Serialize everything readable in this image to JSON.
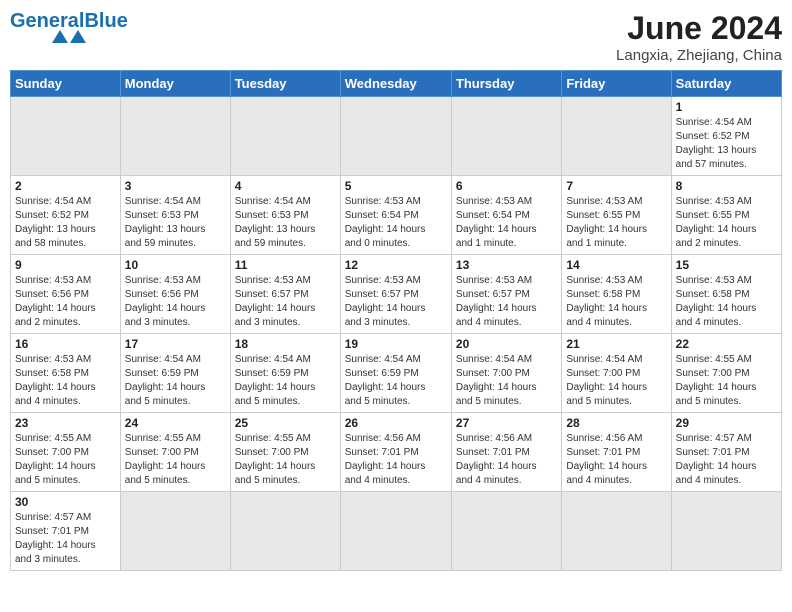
{
  "header": {
    "logo_general": "General",
    "logo_blue": "Blue",
    "month_year": "June 2024",
    "location": "Langxia, Zhejiang, China"
  },
  "weekdays": [
    "Sunday",
    "Monday",
    "Tuesday",
    "Wednesday",
    "Thursday",
    "Friday",
    "Saturday"
  ],
  "weeks": [
    [
      {
        "day": "",
        "info": "",
        "empty": true
      },
      {
        "day": "",
        "info": "",
        "empty": true
      },
      {
        "day": "",
        "info": "",
        "empty": true
      },
      {
        "day": "",
        "info": "",
        "empty": true
      },
      {
        "day": "",
        "info": "",
        "empty": true
      },
      {
        "day": "",
        "info": "",
        "empty": true
      },
      {
        "day": "1",
        "info": "Sunrise: 4:54 AM\nSunset: 6:52 PM\nDaylight: 13 hours\nand 57 minutes."
      }
    ],
    [
      {
        "day": "2",
        "info": "Sunrise: 4:54 AM\nSunset: 6:52 PM\nDaylight: 13 hours\nand 58 minutes."
      },
      {
        "day": "3",
        "info": "Sunrise: 4:54 AM\nSunset: 6:53 PM\nDaylight: 13 hours\nand 59 minutes."
      },
      {
        "day": "4",
        "info": "Sunrise: 4:54 AM\nSunset: 6:53 PM\nDaylight: 13 hours\nand 59 minutes."
      },
      {
        "day": "5",
        "info": "Sunrise: 4:53 AM\nSunset: 6:54 PM\nDaylight: 14 hours\nand 0 minutes."
      },
      {
        "day": "6",
        "info": "Sunrise: 4:53 AM\nSunset: 6:54 PM\nDaylight: 14 hours\nand 1 minute."
      },
      {
        "day": "7",
        "info": "Sunrise: 4:53 AM\nSunset: 6:55 PM\nDaylight: 14 hours\nand 1 minute."
      },
      {
        "day": "8",
        "info": "Sunrise: 4:53 AM\nSunset: 6:55 PM\nDaylight: 14 hours\nand 2 minutes."
      }
    ],
    [
      {
        "day": "9",
        "info": "Sunrise: 4:53 AM\nSunset: 6:56 PM\nDaylight: 14 hours\nand 2 minutes."
      },
      {
        "day": "10",
        "info": "Sunrise: 4:53 AM\nSunset: 6:56 PM\nDaylight: 14 hours\nand 3 minutes."
      },
      {
        "day": "11",
        "info": "Sunrise: 4:53 AM\nSunset: 6:57 PM\nDaylight: 14 hours\nand 3 minutes."
      },
      {
        "day": "12",
        "info": "Sunrise: 4:53 AM\nSunset: 6:57 PM\nDaylight: 14 hours\nand 3 minutes."
      },
      {
        "day": "13",
        "info": "Sunrise: 4:53 AM\nSunset: 6:57 PM\nDaylight: 14 hours\nand 4 minutes."
      },
      {
        "day": "14",
        "info": "Sunrise: 4:53 AM\nSunset: 6:58 PM\nDaylight: 14 hours\nand 4 minutes."
      },
      {
        "day": "15",
        "info": "Sunrise: 4:53 AM\nSunset: 6:58 PM\nDaylight: 14 hours\nand 4 minutes."
      }
    ],
    [
      {
        "day": "16",
        "info": "Sunrise: 4:53 AM\nSunset: 6:58 PM\nDaylight: 14 hours\nand 4 minutes."
      },
      {
        "day": "17",
        "info": "Sunrise: 4:54 AM\nSunset: 6:59 PM\nDaylight: 14 hours\nand 5 minutes."
      },
      {
        "day": "18",
        "info": "Sunrise: 4:54 AM\nSunset: 6:59 PM\nDaylight: 14 hours\nand 5 minutes."
      },
      {
        "day": "19",
        "info": "Sunrise: 4:54 AM\nSunset: 6:59 PM\nDaylight: 14 hours\nand 5 minutes."
      },
      {
        "day": "20",
        "info": "Sunrise: 4:54 AM\nSunset: 7:00 PM\nDaylight: 14 hours\nand 5 minutes."
      },
      {
        "day": "21",
        "info": "Sunrise: 4:54 AM\nSunset: 7:00 PM\nDaylight: 14 hours\nand 5 minutes."
      },
      {
        "day": "22",
        "info": "Sunrise: 4:55 AM\nSunset: 7:00 PM\nDaylight: 14 hours\nand 5 minutes."
      }
    ],
    [
      {
        "day": "23",
        "info": "Sunrise: 4:55 AM\nSunset: 7:00 PM\nDaylight: 14 hours\nand 5 minutes."
      },
      {
        "day": "24",
        "info": "Sunrise: 4:55 AM\nSunset: 7:00 PM\nDaylight: 14 hours\nand 5 minutes."
      },
      {
        "day": "25",
        "info": "Sunrise: 4:55 AM\nSunset: 7:00 PM\nDaylight: 14 hours\nand 5 minutes."
      },
      {
        "day": "26",
        "info": "Sunrise: 4:56 AM\nSunset: 7:01 PM\nDaylight: 14 hours\nand 4 minutes."
      },
      {
        "day": "27",
        "info": "Sunrise: 4:56 AM\nSunset: 7:01 PM\nDaylight: 14 hours\nand 4 minutes."
      },
      {
        "day": "28",
        "info": "Sunrise: 4:56 AM\nSunset: 7:01 PM\nDaylight: 14 hours\nand 4 minutes."
      },
      {
        "day": "29",
        "info": "Sunrise: 4:57 AM\nSunset: 7:01 PM\nDaylight: 14 hours\nand 4 minutes."
      }
    ],
    [
      {
        "day": "30",
        "info": "Sunrise: 4:57 AM\nSunset: 7:01 PM\nDaylight: 14 hours\nand 3 minutes.",
        "shaded": false
      },
      {
        "day": "",
        "info": "",
        "empty": true
      },
      {
        "day": "",
        "info": "",
        "empty": true
      },
      {
        "day": "",
        "info": "",
        "empty": true
      },
      {
        "day": "",
        "info": "",
        "empty": true
      },
      {
        "day": "",
        "info": "",
        "empty": true
      },
      {
        "day": "",
        "info": "",
        "empty": true
      }
    ]
  ]
}
